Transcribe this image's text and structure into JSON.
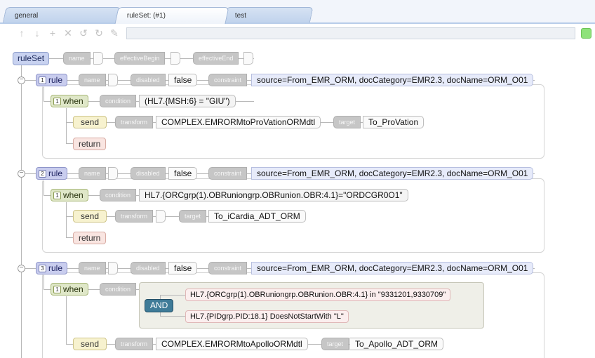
{
  "tabs": [
    {
      "label": "general"
    },
    {
      "label": "ruleSet: (#1)"
    },
    {
      "label": "test"
    }
  ],
  "toolbar": {
    "icons": [
      "up-arrow",
      "down-arrow",
      "add",
      "delete",
      "undo",
      "redo",
      "wrench"
    ],
    "glyphs": [
      "↑",
      "↓",
      "+",
      "✕",
      "↺",
      "↻",
      "✎"
    ],
    "status_color": "#8ee27a"
  },
  "ruleset": {
    "label": "ruleSet",
    "name_label": "name",
    "effective_begin_label": "effectiveBegin",
    "effective_end_label": "effectiveEnd"
  },
  "rules": [
    {
      "num": "1",
      "label": "rule",
      "name_label": "name",
      "disabled_label": "disabled",
      "disabled_value": "false",
      "constraint_label": "constraint",
      "constraint_value": "source=From_EMR_ORM, docCategory=EMR2.3, docName=ORM_O01",
      "when": {
        "num": "1",
        "label": "when",
        "condition_label": "condition",
        "condition_value": "(HL7.{MSH:6} = \"GIU\")"
      },
      "send": {
        "label": "send",
        "transform_label": "transform",
        "transform_value": "COMPLEX.EMRORMtoProVationORMdtl",
        "target_label": "target",
        "target_value": "To_ProVation"
      },
      "return_label": "return"
    },
    {
      "num": "2",
      "label": "rule",
      "name_label": "name",
      "disabled_label": "disabled",
      "disabled_value": "false",
      "constraint_label": "constraint",
      "constraint_value": "source=From_EMR_ORM, docCategory=EMR2.3, docName=ORM_O01",
      "when": {
        "num": "1",
        "label": "when",
        "condition_label": "condition",
        "condition_value": "HL7.{ORCgrp(1).OBRuniongrp.OBRunion.OBR:4.1}=\"ORDCGR0O1\""
      },
      "send": {
        "label": "send",
        "transform_label": "transform",
        "transform_value": "",
        "target_label": "target",
        "target_value": "To_iCardia_ADT_ORM"
      },
      "return_label": "return"
    },
    {
      "num": "3",
      "label": "rule",
      "name_label": "name",
      "disabled_label": "disabled",
      "disabled_value": "false",
      "constraint_label": "constraint",
      "constraint_value": "source=From_EMR_ORM, docCategory=EMR2.3, docName=ORM_O01",
      "when": {
        "num": "1",
        "label": "when",
        "condition_label": "condition",
        "operator": "AND",
        "conditions": [
          "HL7.{ORCgrp(1).OBRuniongrp.OBRunion.OBR:4.1} in \"9331201,9330709\"",
          "HL7.{PIDgrp.PID:18.1} DoesNotStartWith \"L\""
        ]
      },
      "send": {
        "label": "send",
        "transform_label": "transform",
        "transform_value": "COMPLEX.EMRORMtoApolloORMdtl",
        "target_label": "target",
        "target_value": "To_Apollo_ADT_ORM"
      }
    }
  ]
}
